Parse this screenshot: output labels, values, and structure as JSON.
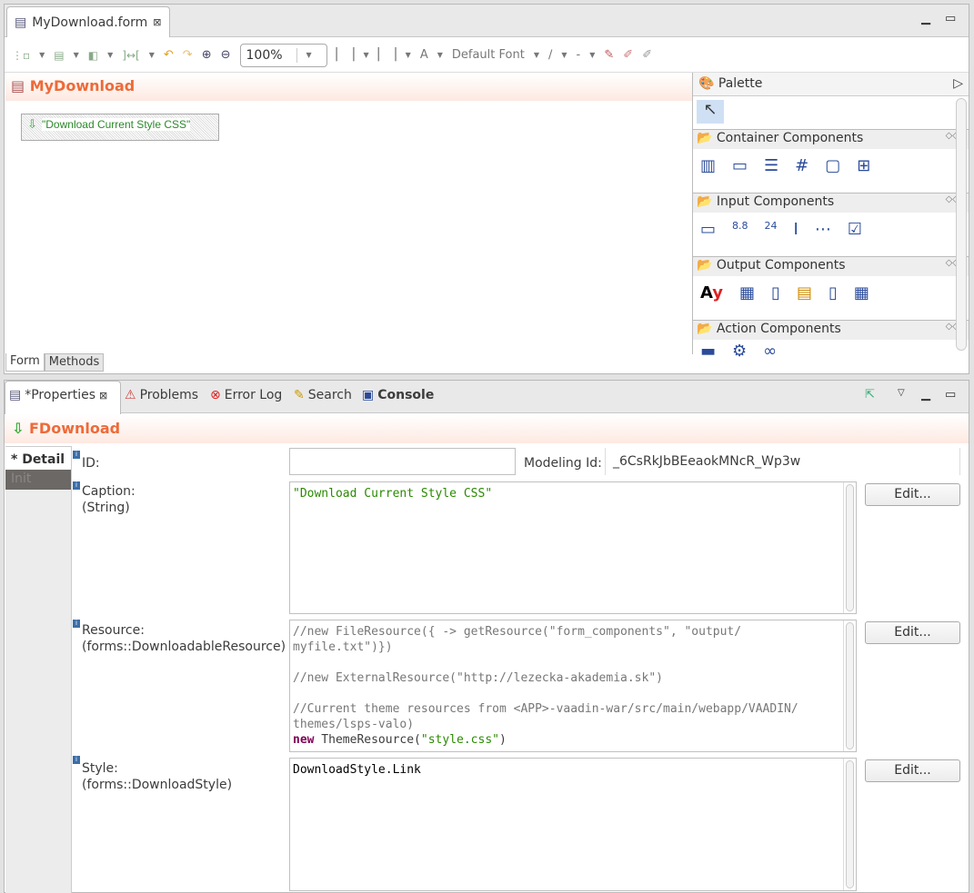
{
  "editor": {
    "tab_title": "MyDownload.form",
    "form_title": "MyDownload",
    "zoom": "100%",
    "font": "Default Font",
    "component_caption": "\"Download Current Style CSS\"",
    "bottom_tabs": [
      "Form",
      "Methods"
    ]
  },
  "palette": {
    "title": "Palette",
    "sections": [
      {
        "label": "Container Components",
        "icons": [
          "vertical-layout-icon",
          "horizontal-layout-icon",
          "form-layout-icon",
          "grid-layout-icon",
          "panel-icon",
          "tab-icon"
        ]
      },
      {
        "label": "Input Components",
        "icons": [
          "text-field-icon",
          "decimal-field-icon",
          "date-field-icon",
          "text-area-icon",
          "password-field-icon",
          "check-box-icon"
        ]
      },
      {
        "label": "Output Components",
        "icons": [
          "label-icon",
          "table-icon",
          "list-icon",
          "grid-icon",
          "tree-icon",
          "tree-table-icon"
        ]
      },
      {
        "label": "Action Components",
        "icons": [
          "button-icon",
          "action-link-icon",
          "link-icon"
        ]
      }
    ]
  },
  "views": {
    "tabs": [
      {
        "label": "*Properties",
        "active": true
      },
      {
        "label": "Problems"
      },
      {
        "label": "Error Log"
      },
      {
        "label": "Search"
      },
      {
        "label": "Console",
        "bold": true
      }
    ]
  },
  "properties": {
    "title": "FDownload",
    "side_tabs": [
      "* Detail",
      "Init"
    ],
    "id_label": "ID:",
    "id_value": "",
    "modeling_id_label": "Modeling Id:",
    "modeling_id": "_6CsRkJbBEeaokMNcR_Wp3w",
    "caption_label": "Caption:",
    "caption_type": "(String)",
    "caption_value": "\"Download Current Style CSS\"",
    "resource_label": "Resource:",
    "resource_type": "(forms::DownloadableResource)",
    "resource_lines": [
      "//new FileResource({ -> getResource(\"form_components\", \"output/",
      "myfile.txt\")})",
      "",
      "//new ExternalResource(\"http://lezecka-akademia.sk\")",
      "",
      "//Current theme resources from <APP>-vaadin-war/src/main/webapp/VAADIN/",
      "themes/lsps-valo)"
    ],
    "resource_kw": "new",
    "resource_call": " ThemeResource(",
    "resource_str": "\"style.css\"",
    "resource_end": ")",
    "style_label": "Style:",
    "style_type": "(forms::DownloadStyle)",
    "style_value": "DownloadStyle.Link",
    "edit_label": "Edit..."
  }
}
